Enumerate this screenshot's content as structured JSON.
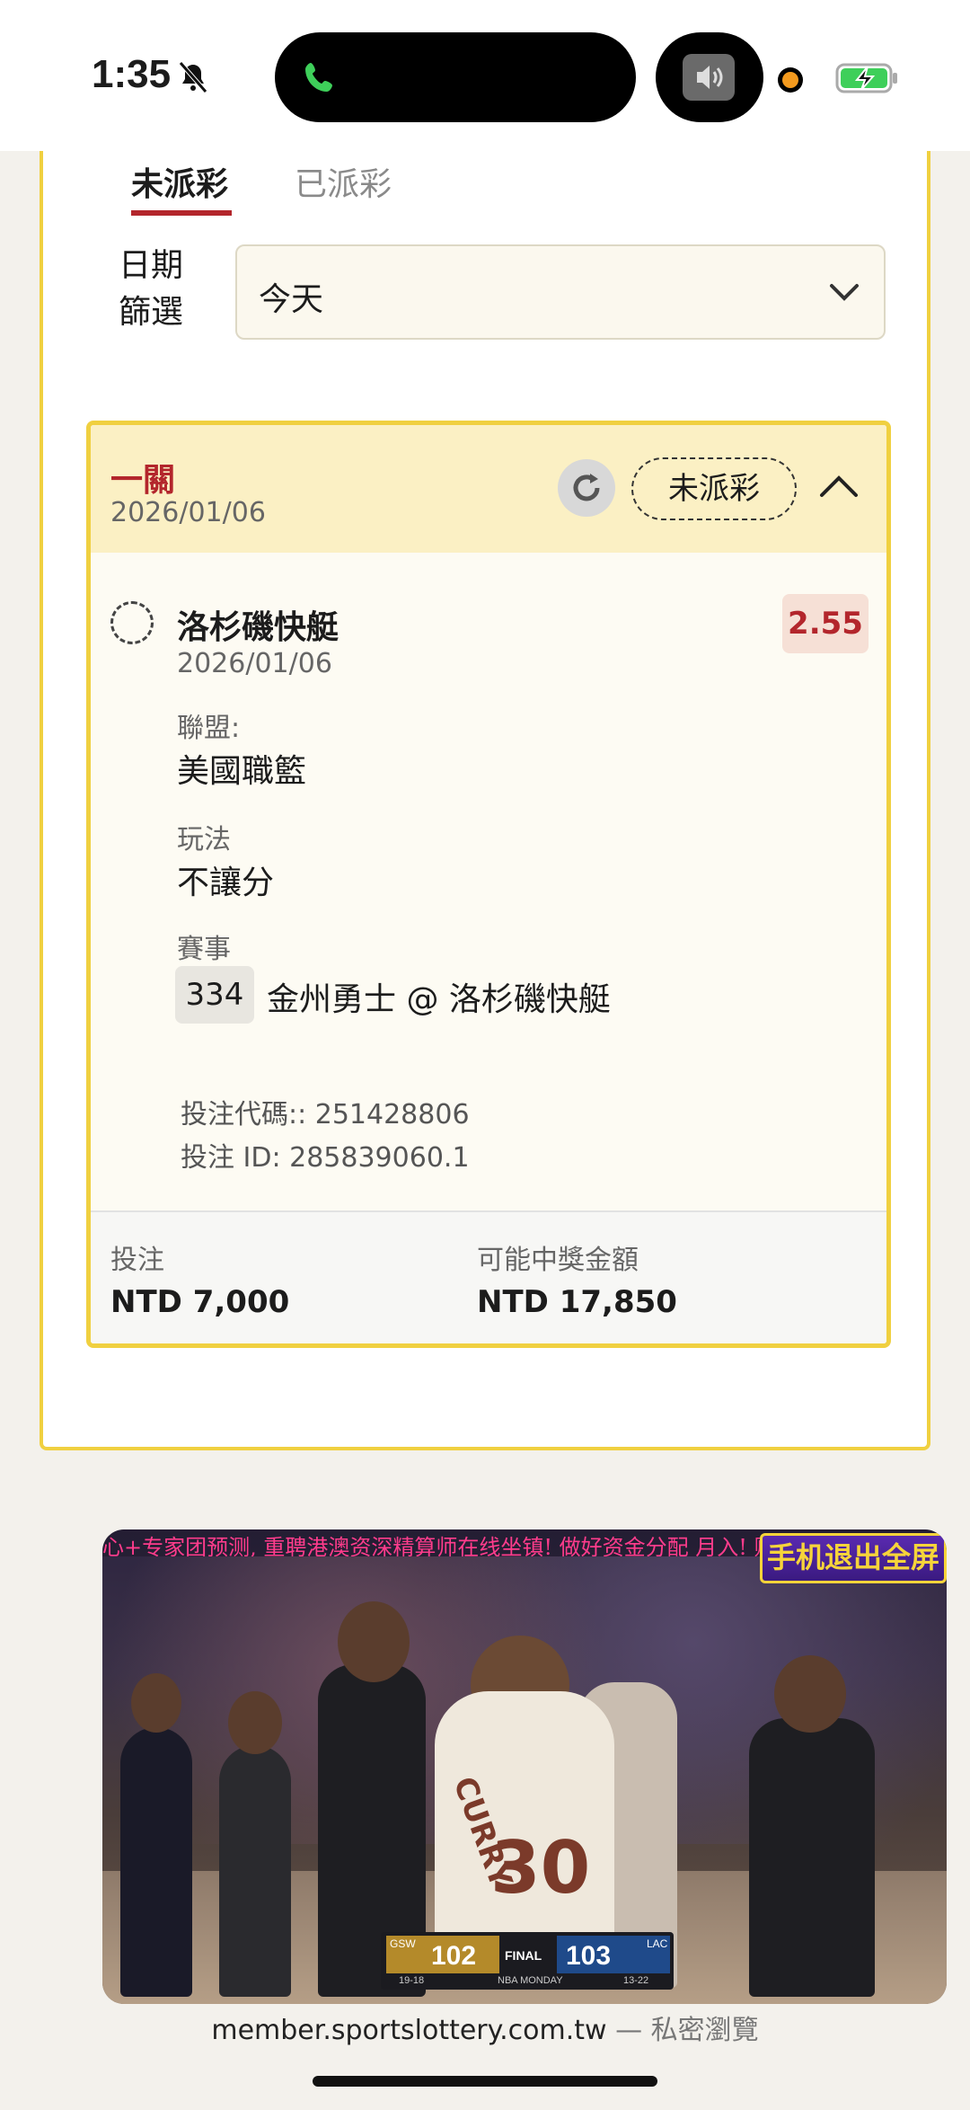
{
  "status_bar": {
    "time": "1:35",
    "icons": [
      "bell-slash-icon",
      "phone-icon",
      "speaker-icon",
      "mic-indicator",
      "battery-charging-icon"
    ]
  },
  "tabs": [
    {
      "label": "未派彩",
      "active": true
    },
    {
      "label": "已派彩",
      "active": false
    }
  ],
  "date_filter": {
    "label_line1": "日期",
    "label_line2": "篩選",
    "value": "今天"
  },
  "bet": {
    "type": "一關",
    "date": "2026/01/06",
    "status": "未派彩",
    "selection": {
      "team": "洛杉磯快艇",
      "date": "2026/01/06",
      "odds": "2.55"
    },
    "league_label": "聯盟:",
    "league_value": "美國職籃",
    "play_label": "玩法",
    "play_value": "不讓分",
    "event_label": "賽事",
    "event_number": "334",
    "event_name": "金州勇士 @ 洛杉磯快艇",
    "bet_code": "投注代碼:: 251428806",
    "bet_id": "投注 ID: 285839060.1",
    "stake_label": "投注",
    "stake_value": "NTD 7,000",
    "payout_label": "可能中獎金額",
    "payout_value": "NTD 17,850"
  },
  "video": {
    "marquee": "心+专家团预测, 重聘港澳资深精算师在线坐镇! 做好资金分配 月入! 财富自由! 点击",
    "badge": "手机退出全屏",
    "jersey_name": "CURRY",
    "jersey_number": "30",
    "scorebug": {
      "home_abbr": "GSW",
      "home_score": "102",
      "home_record": "19-18",
      "status": "FINAL",
      "away_score": "103",
      "away_abbr": "LAC",
      "away_record": "13-22",
      "broadcast": "NBA MONDAY"
    }
  },
  "browser": {
    "url": "member.sportslottery.com.tw",
    "separator": " — ",
    "mode": "私密瀏覽"
  }
}
